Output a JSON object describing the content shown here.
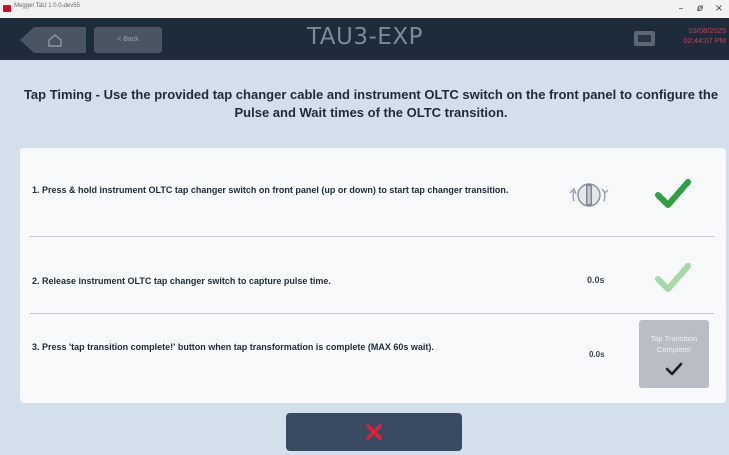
{
  "window": {
    "title": "Megger TaU 1.0.0-dev55",
    "controls": {
      "minimize": "–",
      "maximize": "ø",
      "close": "×"
    }
  },
  "header": {
    "back_label": "< Back",
    "title": "TAU3-EXP",
    "date": "03/08/2025",
    "time": "02:44:07 PM"
  },
  "instruction": "Tap Timing - Use the provided tap changer cable and instrument OLTC switch on the front panel to configure the Pulse and Wait times of the OLTC transition.",
  "steps": [
    {
      "text": "1. Press & hold instrument OLTC tap changer switch on front panel (up or down) to start tap changer transition.",
      "status": "complete"
    },
    {
      "text": "2. Release instrument OLTC tap changer switch to capture pulse time.",
      "value": "0.0s",
      "status": "pending"
    },
    {
      "text": "3. Press 'tap transition complete!' button when tap transformation is complete (MAX 60s wait).",
      "value": "0.0s",
      "button_label": "Tap Transition Complete!"
    }
  ],
  "icons": {
    "home": "home-icon",
    "device": "device-icon",
    "switch": "rotary-switch-icon",
    "check": "checkmark-icon",
    "cancel": "close-icon"
  },
  "colors": {
    "check_active": "#2ea043",
    "check_inactive": "#a6d9a6",
    "cancel_x": "#e0203a",
    "header_bg": "#1e2b3b"
  }
}
